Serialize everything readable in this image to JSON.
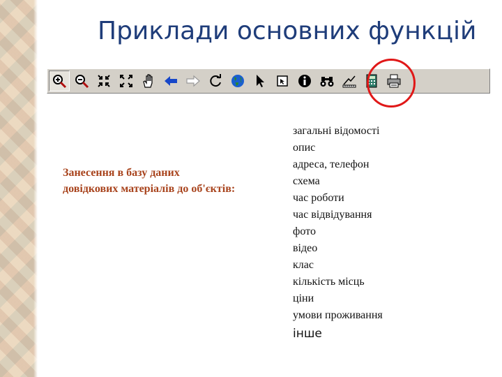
{
  "title": "Приклади основних функцій",
  "toolbar": {
    "buttons": [
      {
        "icon": "zoom-in-icon",
        "pressed": true
      },
      {
        "icon": "zoom-out-icon"
      },
      {
        "icon": "shrink-icon"
      },
      {
        "icon": "expand-icon"
      },
      {
        "icon": "hand-pan-icon"
      },
      {
        "icon": "arrow-back-icon"
      },
      {
        "icon": "arrow-forward-icon"
      },
      {
        "icon": "refresh-icon"
      },
      {
        "icon": "globe-icon"
      },
      {
        "icon": "pointer-icon"
      },
      {
        "icon": "select-box-icon"
      },
      {
        "icon": "info-icon"
      },
      {
        "icon": "binoculars-icon",
        "highlighted": true
      },
      {
        "icon": "measure-icon"
      },
      {
        "icon": "calculator-icon"
      },
      {
        "icon": "printer-icon"
      }
    ],
    "highlight_color": "#e01818"
  },
  "left_caption": "Занесення в базу даних довідкових матеріалів до об'єктів:",
  "info_list": [
    "загальні відомості",
    "опис",
    "адреса, телефон",
    "схема",
    "час роботи",
    "час відвідування",
    "фото",
    "відео",
    "клас",
    "кількість місць",
    "ціни",
    "умови проживання",
    "інше"
  ],
  "colors": {
    "title": "#1f3d7a",
    "caption": "#a8431c",
    "toolbar_bg": "#d4d0c8"
  }
}
